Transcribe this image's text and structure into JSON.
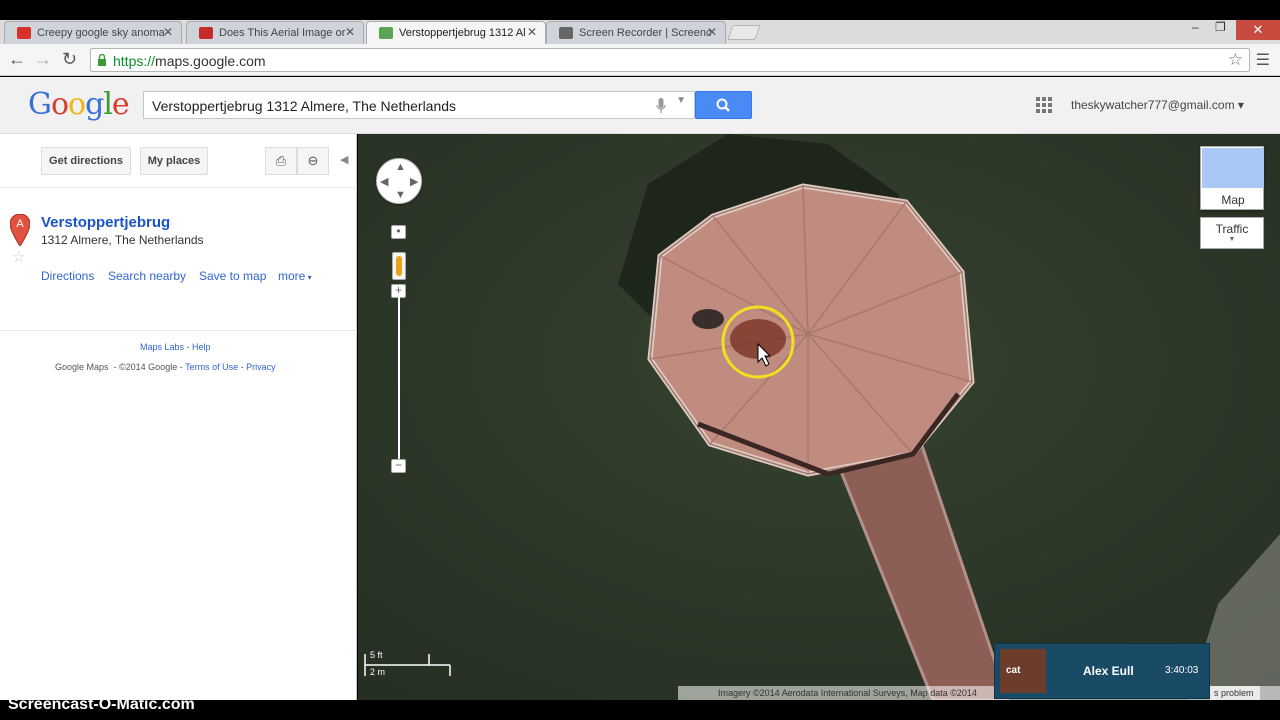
{
  "browser": {
    "tabs": [
      {
        "label": "Creepy google sky anoma",
        "favicon": "youtube-icon",
        "color": "#d9302b"
      },
      {
        "label": "Does This Aerial Image or",
        "favicon": "yahoo-news-icon",
        "color": "#c62b2b"
      },
      {
        "label": "Verstoppertjebrug 1312 Al",
        "favicon": "google-maps-icon",
        "color": "#5aa555"
      },
      {
        "label": "Screen Recorder | Screenc",
        "favicon": "screencast-icon",
        "color": "#666666"
      }
    ],
    "url_scheme": "https://",
    "url_host": "maps.google.com"
  },
  "google": {
    "logo": "Google",
    "search_query": "Verstoppertjebrug 1312 Almere, The Netherlands",
    "account": "theskywatcher777@gmail.com"
  },
  "leftpanel": {
    "get_directions": "Get directions",
    "my_places": "My places",
    "place_marker": "A",
    "place_title": "Verstoppertjebrug",
    "place_address": "1312 Almere, The Netherlands",
    "links": {
      "directions": "Directions",
      "search_nearby": "Search nearby",
      "save_to_map": "Save to map",
      "more": "more"
    },
    "footer": {
      "maps_labs": "Maps Labs",
      "help": "Help",
      "google_maps": "Google Maps",
      "copyright": "©2014 Google",
      "terms": "Terms of Use",
      "privacy": "Privacy"
    }
  },
  "map": {
    "maptype_label": "Map",
    "traffic_label": "Traffic",
    "scale_ft": "5 ft",
    "scale_m": "2 m",
    "attribution": "Imagery ©2014 Aerodata International Surveys, Map data ©2014",
    "report_problem": "s problem"
  },
  "recorder": {
    "poster_text": "cat",
    "user": "Alex Eull",
    "time": "3:40:03"
  },
  "watermark": "Screencast-O-Matic.com"
}
